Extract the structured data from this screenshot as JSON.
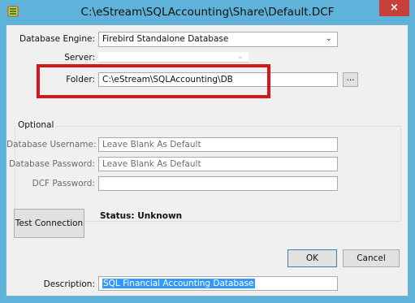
{
  "window": {
    "title": "C:\\eStream\\SQLAccounting\\Share\\Default.DCF",
    "close_label": "×"
  },
  "form": {
    "engine_label": "Database Engine:",
    "engine_value": "Firebird Standalone Database",
    "server_label": "Server:",
    "server_value": "",
    "folder_label": "Folder:",
    "folder_value": "C:\\eStream\\SQLAccounting\\DB",
    "browse_label": "..."
  },
  "optional": {
    "group_title": "Optional",
    "username_label": "Database Username:",
    "username_placeholder": "Leave Blank As Default",
    "password_label": "Database Password:",
    "password_placeholder": "Leave Blank As Default",
    "dcf_password_label": "DCF Password:",
    "dcf_password_value": ""
  },
  "connection": {
    "test_label": "Test Connection",
    "status_text": "Status: Unknown"
  },
  "buttons": {
    "ok_label": "OK",
    "cancel_label": "Cancel"
  },
  "description": {
    "label": "Description:",
    "value": "SQL Financial Accounting Database"
  },
  "colors": {
    "title_bar": "#5fb2d9",
    "close_button": "#c7413a",
    "highlight_box": "#d5171b",
    "selection": "#3399ff"
  },
  "icons": {
    "app": "database-icon",
    "dropdown": "chevron-down-icon"
  }
}
